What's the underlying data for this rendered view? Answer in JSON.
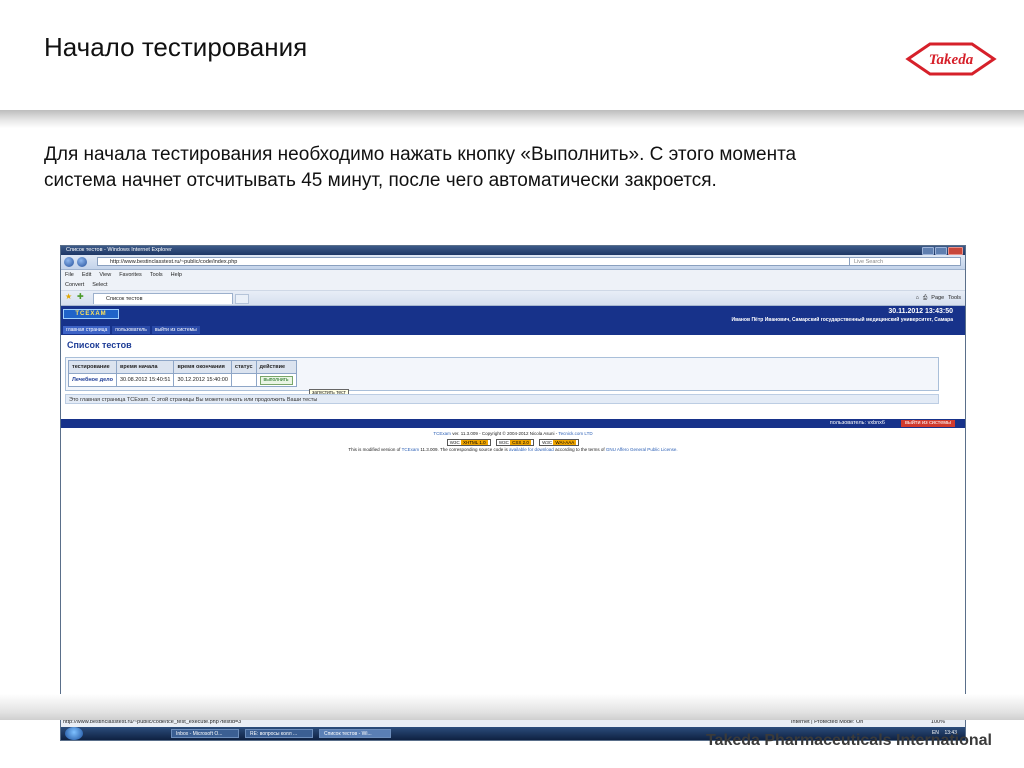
{
  "slide": {
    "title": "Начало тестирования",
    "logo_text": "Takeda",
    "body": "Для начала тестирования необходимо нажать кнопку «Выполнить». С этого момента система начнет отсчитывать 45 минут, после чего автоматически закроется.",
    "footer_brand": "Takeda Pharmaceuticals International"
  },
  "browser": {
    "window_title": "Список тестов - Windows Internet Explorer",
    "address": "http://www.bestinclasstest.ru/~public/code/index.php",
    "search_placeholder": "Live Search",
    "menu": [
      "File",
      "Edit",
      "View",
      "Favorites",
      "Tools",
      "Help"
    ],
    "convert_label": "Convert",
    "select_label": "Select",
    "tab_title": "Список тестов",
    "page_label": "Page",
    "tools_label": "Tools"
  },
  "app": {
    "logo": "TCEXAM",
    "datetime": "30.11.2012 13:43:50",
    "user_info": "Иванов Пётр Иванович, Самарский государственный медицинский университет, Самара",
    "nav": [
      "главная страница",
      "пользователь",
      "выйти из системы"
    ],
    "list_title": "Список тестов",
    "table": {
      "headers": [
        "тестирование",
        "время начала",
        "время окончания",
        "статус",
        "действие"
      ],
      "rows": [
        {
          "name": "Лечебное дело",
          "start": "30.08.2012 15:40:51",
          "end": "30.12.2012 15:40:00",
          "status": "",
          "action": "выполнить"
        }
      ]
    },
    "tooltip": "запустить тест",
    "info": "Это главная страница TCExam. С этой страницы Вы можете начать или продолжить Ваши тесты",
    "bottom_user": "пользователь: vxbnx6",
    "bottom_logout": "выйти из системы",
    "footer_line1_pre": "TCExam",
    "footer_line1_post": "ver. 11.3.009 - Copyright © 2004-2012 Nicola Asuni -",
    "footer_line1_link": "Tecnick.com LTD",
    "badges": [
      {
        "label": "W3C",
        "value": "XHTML 1.0"
      },
      {
        "label": "W3C",
        "value": "CSS 2.0"
      },
      {
        "label": "W3C",
        "value": "WAI-AAA"
      }
    ],
    "footer_line3_pre": "This is modified version of",
    "footer_line3_name": "TCExam",
    "footer_line3_mid": "11.3.009. The corresponding source code is",
    "footer_line3_link1": "available for download",
    "footer_line3_mid2": "according to the terms of",
    "footer_line3_link2": "GNU Affero General Public License."
  },
  "statusbar": {
    "url": "http://www.bestinclasstest.ru/~public/code/tce_test_execute.php?testid=3",
    "zone": "Internet | Protected Mode: On",
    "zoom": "100%"
  },
  "taskbar": {
    "items": [
      "Inbox - Microsoft O...",
      "RE: вопросы колл ...",
      "Список тестов - Wi..."
    ],
    "tray_lang": "EN",
    "tray_time": "13:43"
  }
}
